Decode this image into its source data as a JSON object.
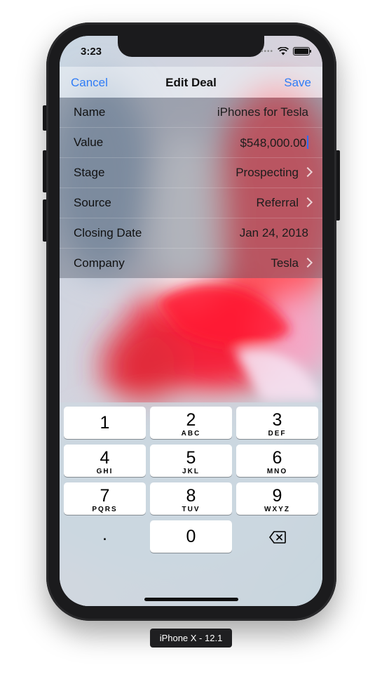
{
  "status": {
    "time": "3:23"
  },
  "nav": {
    "cancel": "Cancel",
    "title": "Edit Deal",
    "save": "Save"
  },
  "form": {
    "rows": [
      {
        "label": "Name",
        "value": "iPhones for Tesla"
      },
      {
        "label": "Value",
        "value": "$548,000.00"
      },
      {
        "label": "Stage",
        "value": "Prospecting"
      },
      {
        "label": "Source",
        "value": "Referral"
      },
      {
        "label": "Closing Date",
        "value": "Jan 24, 2018"
      },
      {
        "label": "Company",
        "value": "Tesla"
      }
    ]
  },
  "keypad": {
    "keys": [
      {
        "num": "1",
        "letters": ""
      },
      {
        "num": "2",
        "letters": "ABC"
      },
      {
        "num": "3",
        "letters": "DEF"
      },
      {
        "num": "4",
        "letters": "GHI"
      },
      {
        "num": "5",
        "letters": "JKL"
      },
      {
        "num": "6",
        "letters": "MNO"
      },
      {
        "num": "7",
        "letters": "PQRS"
      },
      {
        "num": "8",
        "letters": "TUV"
      },
      {
        "num": "9",
        "letters": "WXYZ"
      },
      {
        "num": "0",
        "letters": ""
      }
    ],
    "dot": "."
  },
  "device_label": "iPhone X - 12.1",
  "colors": {
    "accent": "#2f7cf6",
    "device": "#1b1b1d"
  }
}
